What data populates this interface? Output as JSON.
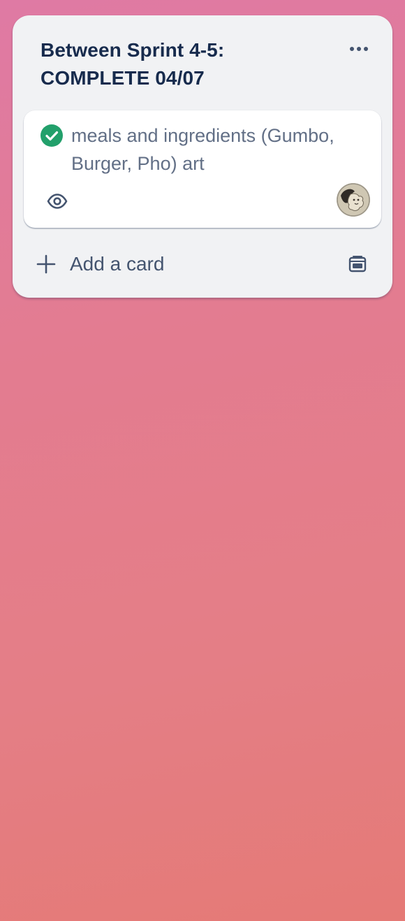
{
  "list": {
    "title": "Between Sprint 4-5: COMPLETE 04/07",
    "menu_icon": "more-horizontal-icon",
    "cards": [
      {
        "title": "meals and ingredients (Gumbo, Burger, Pho) art",
        "status_icon": "check-circle-icon",
        "status_color": "#4bce97",
        "badges": [
          "eye-icon"
        ],
        "member_avatar": "avatar"
      }
    ],
    "add_card_label": "Add a card",
    "add_card_icon": "plus-icon",
    "template_icon": "card-template-icon"
  },
  "colors": {
    "list_bg": "#f1f2f4",
    "title_text": "#172b4d",
    "card_text": "#626f86",
    "button_text": "#44546f",
    "complete_green": "#22a06b"
  }
}
